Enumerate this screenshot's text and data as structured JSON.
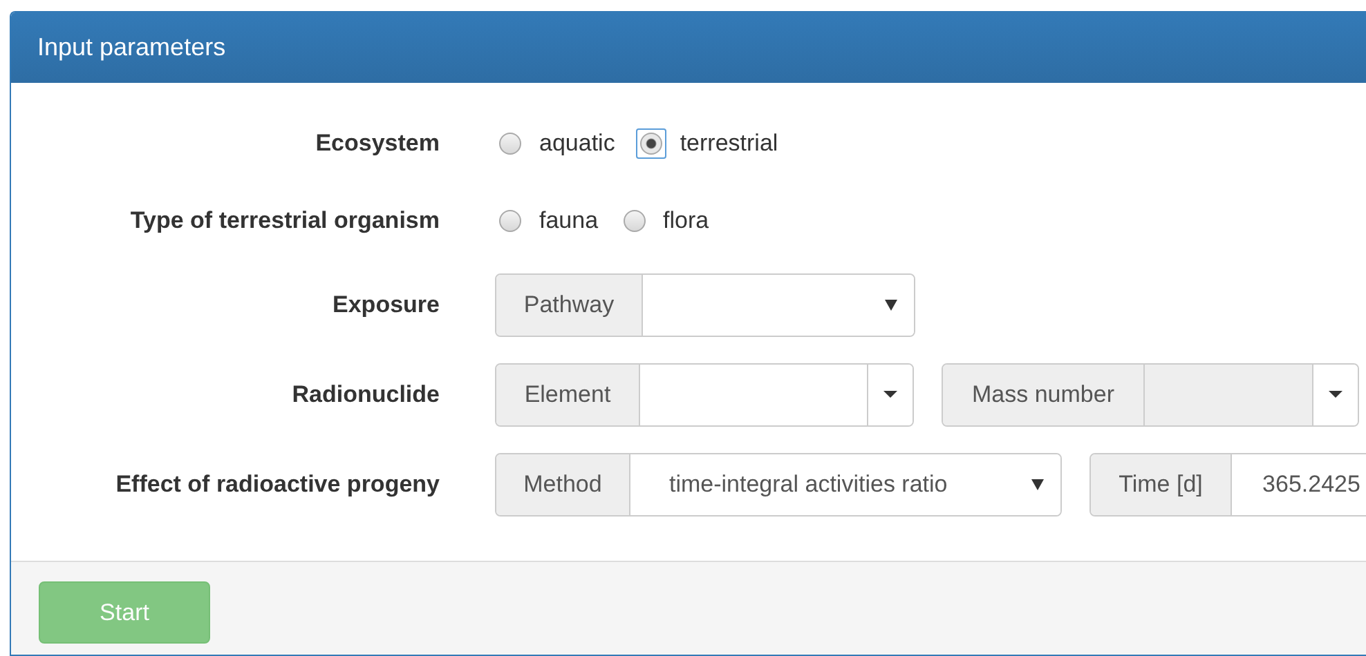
{
  "panel": {
    "title": "Input parameters"
  },
  "rows": [
    {
      "label": "Ecosystem",
      "kind": "radio",
      "options": [
        {
          "label": "aquatic",
          "selected": false,
          "focused": false
        },
        {
          "label": "terrestrial",
          "selected": true,
          "focused": true
        }
      ]
    },
    {
      "label": "Type of terrestrial organism",
      "kind": "radio",
      "options": [
        {
          "label": "fauna",
          "selected": false,
          "focused": false
        },
        {
          "label": "flora",
          "selected": false,
          "focused": false
        }
      ]
    },
    {
      "label": "Exposure",
      "kind": "inputs",
      "groups": [
        {
          "addon": "Pathway",
          "field": {
            "kind": "select",
            "disabled": false
          }
        }
      ]
    },
    {
      "label": "Radionuclide",
      "kind": "inputs",
      "groups": [
        {
          "addon": "Element",
          "field": {
            "kind": "combo",
            "disabled": false
          }
        },
        {
          "addon": "Mass number",
          "field": {
            "kind": "combo",
            "disabled": true
          }
        }
      ]
    },
    {
      "label": "Effect of radioactive progeny",
      "kind": "inputs",
      "groups": [
        {
          "addon": "Method",
          "field": {
            "kind": "select",
            "value": "time-integral activities ratio",
            "disabled": false
          }
        },
        {
          "addon": "Time [d]",
          "field": {
            "kind": "text",
            "value": "365.2425",
            "disabled": false
          }
        }
      ]
    }
  ],
  "footer": {
    "button": {
      "label": "Start",
      "disabled": true
    }
  }
}
